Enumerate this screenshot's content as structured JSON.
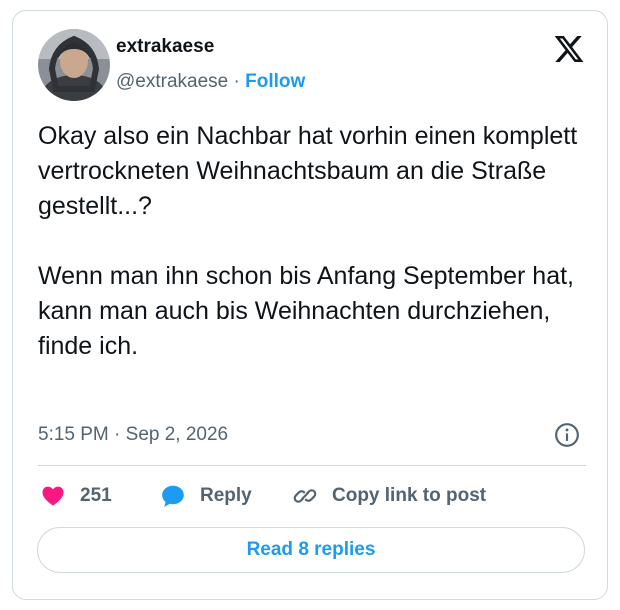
{
  "user": {
    "name": "extrakaese",
    "handle": "@extrakaese",
    "separator": "·",
    "follow_label": "Follow"
  },
  "icons": {
    "brand": "x-logo-icon",
    "info": "info-icon",
    "like": "heart-icon",
    "reply": "speech-bubble-icon",
    "copy": "link-icon"
  },
  "tweet": {
    "paragraphs": [
      "Okay also ein Nachbar hat vorhin einen komplett vertrockneten Weihnachtsbaum an die Straße gestellt...?",
      "Wenn man ihn schon bis Anfang September hat, kann man auch bis Weihnachten durchziehen, finde ich."
    ],
    "timestamp": "5:15 PM · Sep 2, 2026"
  },
  "actions": {
    "like_count": "251",
    "reply_label": "Reply",
    "copy_label": "Copy link to post"
  },
  "read_replies_label": "Read 8 replies",
  "colors": {
    "accent": "#1d9bf0",
    "like": "#f91880",
    "text": "#0f1419",
    "muted": "#536471",
    "border": "#cfd9de"
  }
}
